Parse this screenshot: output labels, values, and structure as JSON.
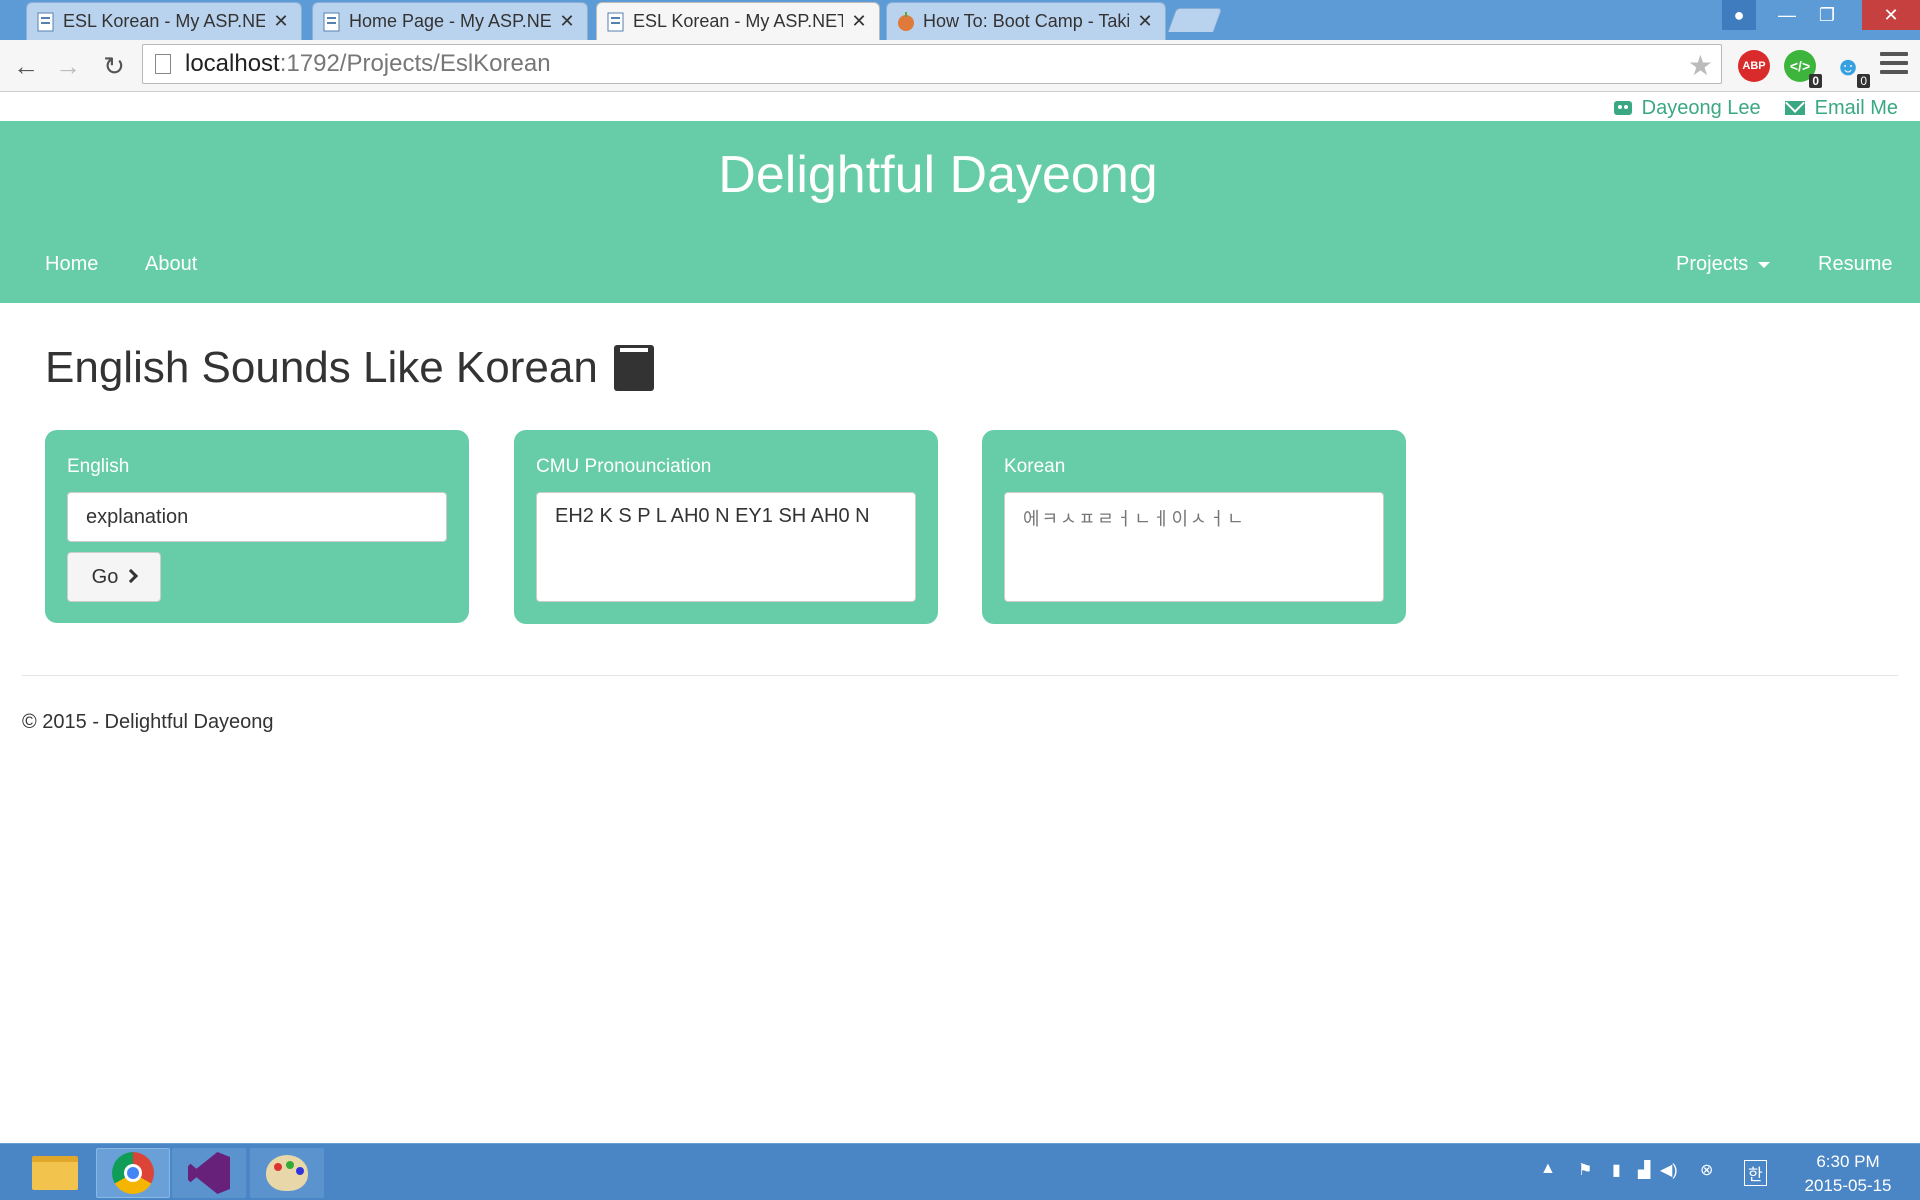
{
  "browser": {
    "tabs": [
      {
        "title": "ESL Korean - My ASP.NET",
        "active": false
      },
      {
        "title": "Home Page - My ASP.NET",
        "active": false
      },
      {
        "title": "ESL Korean - My ASP.NET",
        "active": true
      },
      {
        "title": "How To: Boot Camp - Taki",
        "active": false
      }
    ],
    "url_host": "localhost",
    "url_path": ":1792/Projects/EslKorean",
    "extensions": {
      "abp_label": "ABP",
      "code_badge": "0",
      "ghost_badge": "0"
    }
  },
  "site": {
    "top_links": {
      "github": "Dayeong Lee",
      "email": "Email Me"
    },
    "title": "Delightful Dayeong",
    "nav": {
      "home": "Home",
      "about": "About",
      "projects": "Projects",
      "resume": "Resume"
    },
    "accent_color": "#66cda8"
  },
  "main": {
    "heading": "English Sounds Like Korean",
    "english_panel": {
      "label": "English",
      "input_value": "explanation",
      "go_label": "Go"
    },
    "cmu_panel": {
      "label": "CMU Pronounciation",
      "output": "EH2 K S P L AH0 N EY1 SH AH0 N"
    },
    "korean_panel": {
      "label": "Korean",
      "output": "에ㅋㅅㅍㄹㅓㄴㅔ이ㅅㅓㄴ"
    }
  },
  "footer": {
    "text": "© 2015 - Delightful Dayeong"
  },
  "taskbar": {
    "ime": "한",
    "time": "6:30 PM",
    "date": "2015-05-15"
  }
}
